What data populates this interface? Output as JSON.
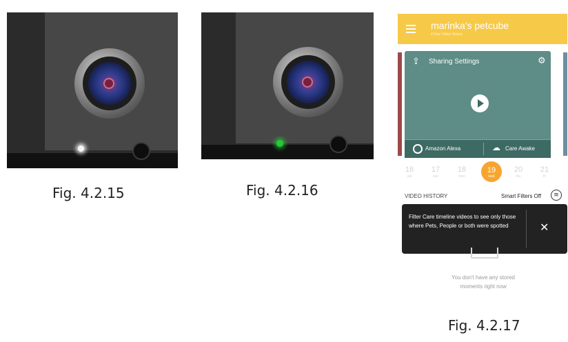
{
  "captions": {
    "fig1": "Fig. 4.2.15",
    "fig2": "Fig. 4.2.16",
    "fig3": "Fig. 4.2.17"
  },
  "photos": {
    "fig1_led_color": "#f5f5f5",
    "fig2_led_color": "#22cc33"
  },
  "app": {
    "title": "marinka's petcube",
    "subtitle": "4 Hour Video History",
    "accent": "#f7c948",
    "card": {
      "sharing_label": "Sharing Settings",
      "alexa_label": "Amazon Alexa",
      "care_label": "Care Awake"
    },
    "dates": [
      {
        "num": "16",
        "day": "sat"
      },
      {
        "num": "17",
        "day": "sun"
      },
      {
        "num": "18",
        "day": "mon"
      },
      {
        "num": "19",
        "day": "wed"
      },
      {
        "num": "20",
        "day": "thu"
      },
      {
        "num": "21",
        "day": "fri"
      }
    ],
    "history_label": "VIDEO HISTORY",
    "smart_filters": "Smart Filters Off",
    "tooltip_text": "Filter Care timeline videos to see only those where Pets, People or both were spotted",
    "empty_text": "You don't have any stored moments right now"
  }
}
